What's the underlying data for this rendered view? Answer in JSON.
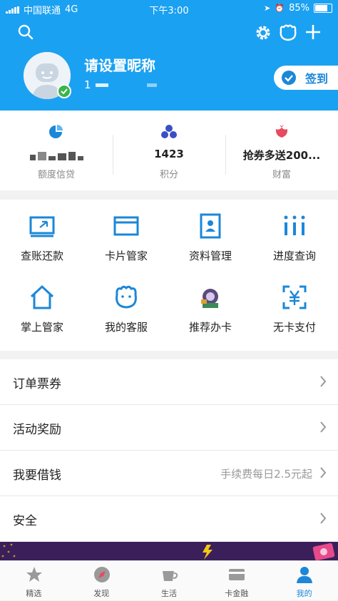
{
  "status_bar": {
    "carrier": "中国联通",
    "network": "4G",
    "time": "下午3:00",
    "battery": "85%",
    "battery_level": 0.85
  },
  "profile": {
    "nickname": "请设置昵称",
    "uid_prefix": "1",
    "signin_label": "签到"
  },
  "stats": [
    {
      "value": "",
      "label": "额度信贷",
      "icon": "pie-chart-icon"
    },
    {
      "value": "1423",
      "label": "积分",
      "icon": "points-icon"
    },
    {
      "value": "抢券多送200...",
      "label": "财富",
      "icon": "wealth-flower-icon"
    }
  ],
  "services": [
    {
      "label": "查账还款",
      "icon": "bill-icon"
    },
    {
      "label": "卡片管家",
      "icon": "card-icon"
    },
    {
      "label": "资料管理",
      "icon": "profile-card-icon"
    },
    {
      "label": "进度查询",
      "icon": "progress-icon"
    },
    {
      "label": "掌上管家",
      "icon": "home-icon"
    },
    {
      "label": "我的客服",
      "icon": "service-mascot-icon"
    },
    {
      "label": "推荐办卡",
      "icon": "recommend-card-icon"
    },
    {
      "label": "无卡支付",
      "icon": "cardless-pay-icon"
    }
  ],
  "menu": [
    {
      "label": "订单票券",
      "sub": ""
    },
    {
      "label": "活动奖励",
      "sub": ""
    },
    {
      "label": "我要借钱",
      "sub": "手续费每日2.5元起"
    },
    {
      "label": "安全",
      "sub": ""
    }
  ],
  "tabs": [
    {
      "label": "精选",
      "icon": "star-icon"
    },
    {
      "label": "发现",
      "icon": "compass-icon"
    },
    {
      "label": "生活",
      "icon": "cup-icon"
    },
    {
      "label": "卡金融",
      "icon": "card-finance-icon"
    },
    {
      "label": "我的",
      "icon": "user-icon",
      "active": true
    }
  ],
  "colors": {
    "brand": "#1ba1f2",
    "accent": "#1b87d8",
    "active_tab": "#1b87d8"
  }
}
